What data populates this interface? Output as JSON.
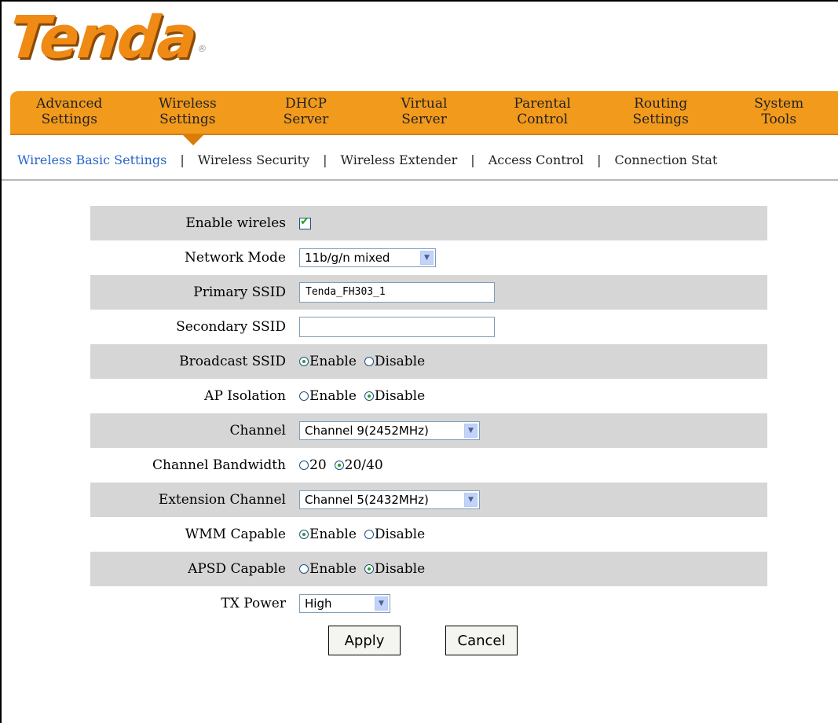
{
  "brand": {
    "logo_text": "Tenda"
  },
  "topnav": [
    {
      "line1": "Advanced",
      "line2": "Settings"
    },
    {
      "line1": "Wireless",
      "line2": "Settings"
    },
    {
      "line1": "DHCP",
      "line2": "Server"
    },
    {
      "line1": "Virtual",
      "line2": "Server"
    },
    {
      "line1": "Parental",
      "line2": "Control"
    },
    {
      "line1": "Routing",
      "line2": "Settings"
    },
    {
      "line1": "System",
      "line2": "Tools"
    }
  ],
  "subnav": {
    "items": [
      "Wireless Basic Settings",
      "Wireless Security",
      "Wireless Extender",
      "Access Control",
      "Connection Stat"
    ],
    "separator": "|",
    "active": "Wireless Basic Settings"
  },
  "form": {
    "enable_wireless": {
      "label": "Enable wireles",
      "checked": true
    },
    "network_mode": {
      "label": "Network Mode",
      "value": "11b/g/n mixed"
    },
    "primary_ssid": {
      "label": "Primary SSID",
      "value": "Tenda_FH303_1"
    },
    "secondary_ssid": {
      "label": "Secondary SSID",
      "value": ""
    },
    "broadcast_ssid": {
      "label": "Broadcast SSID",
      "opt1": "Enable",
      "opt2": "Disable",
      "selected": "Enable"
    },
    "ap_isolation": {
      "label": "AP Isolation",
      "opt1": "Enable",
      "opt2": "Disable",
      "selected": "Disable"
    },
    "channel": {
      "label": "Channel",
      "value": "Channel 9(2452MHz)"
    },
    "channel_bandwidth": {
      "label": "Channel Bandwidth",
      "opt1": "20",
      "opt2": "20/40",
      "selected": "20/40"
    },
    "extension_channel": {
      "label": "Extension Channel",
      "value": "Channel 5(2432MHz)"
    },
    "wmm_capable": {
      "label": "WMM Capable",
      "opt1": "Enable",
      "opt2": "Disable",
      "selected": "Enable"
    },
    "apsd_capable": {
      "label": "APSD Capable",
      "opt1": "Enable",
      "opt2": "Disable",
      "selected": "Disable"
    },
    "tx_power": {
      "label": "TX Power",
      "value": "High"
    }
  },
  "buttons": {
    "apply": "Apply",
    "cancel": "Cancel"
  },
  "colors": {
    "nav_orange": "#f29a1c",
    "active_link": "#2864c8",
    "row_shade": "#d6d6d6"
  }
}
